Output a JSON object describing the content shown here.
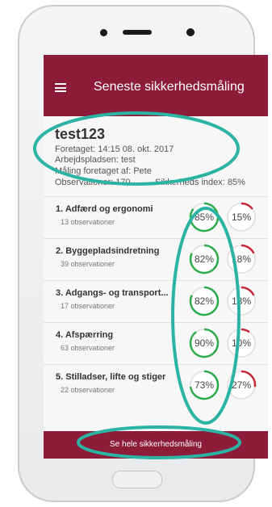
{
  "app": {
    "title": "Seneste sikkerhedsmåling",
    "menu_icon": "hamburger-icon"
  },
  "project": {
    "name": "test123",
    "date_line": "Foretaget: 14:15 08. okt. 2017",
    "workplace_line": "Arbejdspladsen: test",
    "measured_by_line": "Måling foretaget af: Pete",
    "observations_line": "Observationer: 170",
    "safety_index_line": "Sikkerheds index: 85%"
  },
  "categories": [
    {
      "title": "1. Adfærd og ergonomi",
      "subtitle": "13 observationer",
      "positive": 85,
      "negative": 15,
      "positive_label": "85%",
      "negative_label": "15%"
    },
    {
      "title": "2. Byggepladsindretning",
      "subtitle": "39 observationer",
      "positive": 82,
      "negative": 18,
      "positive_label": "82%",
      "negative_label": "18%"
    },
    {
      "title": "3. Adgangs- og transport...",
      "subtitle": "17 observationer",
      "positive": 82,
      "negative": 18,
      "positive_label": "82%",
      "negative_label": "18%"
    },
    {
      "title": "4. Afspærring",
      "subtitle": "63 observationer",
      "positive": 90,
      "negative": 10,
      "positive_label": "90%",
      "negative_label": "10%"
    },
    {
      "title": "5. Stilladser, lifte og stiger",
      "subtitle": "22 observationer",
      "positive": 73,
      "negative": 27,
      "positive_label": "73%",
      "negative_label": "27%"
    }
  ],
  "footer": {
    "button_label": "Se hele sikkerhedsmåling"
  },
  "colors": {
    "brand": "#8c1c3a",
    "positive": "#2eaa4a",
    "negative": "#c6283a",
    "annotation": "#2bb3a3"
  }
}
